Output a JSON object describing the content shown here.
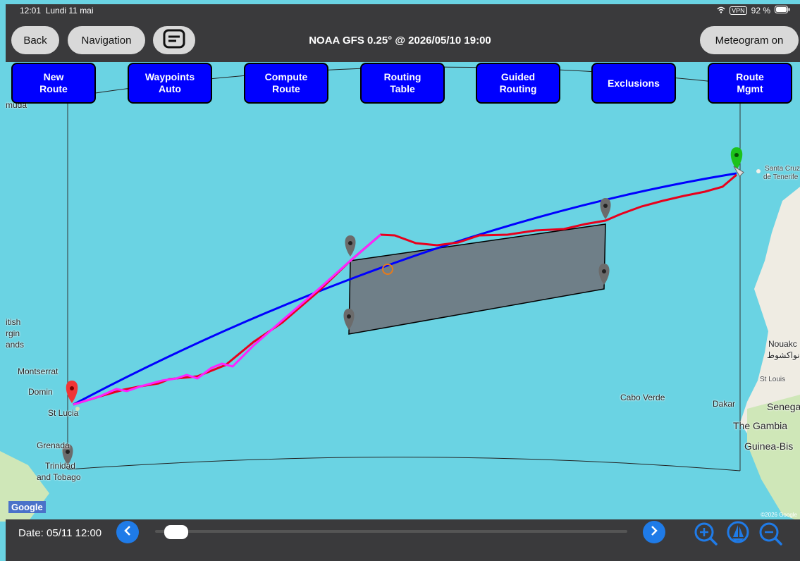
{
  "status_bar": {
    "time": "12:01",
    "date": "Lundi 11 mai",
    "vpn": "VPN",
    "battery": "92 %"
  },
  "nav": {
    "back": "Back",
    "navigation": "Navigation",
    "meteogram": "Meteogram on"
  },
  "header": {
    "title": "NOAA GFS 0.25° @ 2026/05/10 19:00"
  },
  "actions": [
    {
      "label": "New\nRoute"
    },
    {
      "label": "Waypoints\nAuto"
    },
    {
      "label": "Compute\nRoute"
    },
    {
      "label": "Routing\nTable"
    },
    {
      "label": "Guided\nRouting"
    },
    {
      "label": "Exclusions"
    },
    {
      "label": "Route\nMgmt"
    }
  ],
  "map_labels": {
    "bermuda": "muda",
    "bvi_1": "itish",
    "bvi_2": "rgin",
    "bvi_3": "ands",
    "montserrat": "Montserrat",
    "dominica": "Domin",
    "st_lucia": "St Lucia",
    "grenada": "Grenada",
    "trinidad_1": "Trinidad",
    "trinidad_2": "and Tobago",
    "cabo_verde": "Cabo Verde",
    "dakar": "Dakar",
    "senegal": "Senega",
    "gambia": "The Gambia",
    "guinea": "Guinea-Bis",
    "nouakchott": "Nouakc",
    "nouakchott_ar": "نواكشوط",
    "st_louis": "St Louis",
    "tenerife_1": "Santa Cruz",
    "tenerife_2": "de Tenerife",
    "google": "Google",
    "copyright": "©2026 Google"
  },
  "bottom": {
    "date_label": "Date: 05/11 12:00",
    "slider_value": 0.02
  },
  "colors": {
    "sea": "#6ad3e3",
    "great_circle": "#0000ff",
    "route_red": "#e8001c",
    "route_magenta": "#ff22ff",
    "exclusion_fill": "#6f7f88",
    "button_blue": "#0000ff",
    "accent": "#1f7be8"
  },
  "icons": [
    "display-icon",
    "chevron-left-icon",
    "chevron-right-icon",
    "zoom-in-icon",
    "boat-icon",
    "zoom-out-icon",
    "wifi-icon",
    "battery-icon",
    "map-pin-icon"
  ]
}
